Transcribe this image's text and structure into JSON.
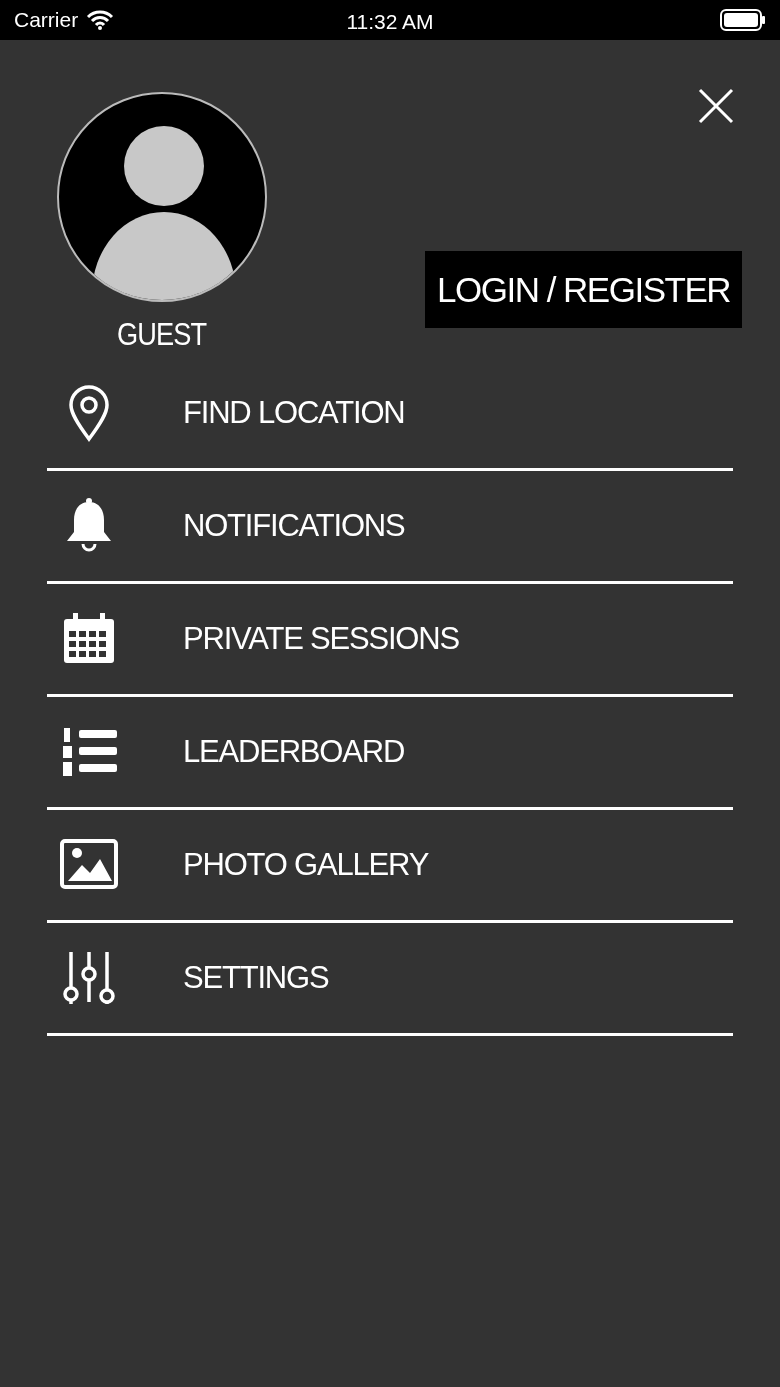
{
  "status_bar": {
    "carrier": "Carrier",
    "time": "11:32 AM"
  },
  "profile": {
    "name": "GUEST"
  },
  "login_button": {
    "label": "LOGIN / REGISTER"
  },
  "menu": [
    {
      "label": "FIND LOCATION",
      "kind": "location"
    },
    {
      "label": "NOTIFICATIONS",
      "kind": "bell"
    },
    {
      "label": "PRIVATE SESSIONS",
      "kind": "calendar"
    },
    {
      "label": "LEADERBOARD",
      "kind": "ranking"
    },
    {
      "label": "PHOTO GALLERY",
      "kind": "gallery"
    },
    {
      "label": "SETTINGS",
      "kind": "settings"
    }
  ]
}
